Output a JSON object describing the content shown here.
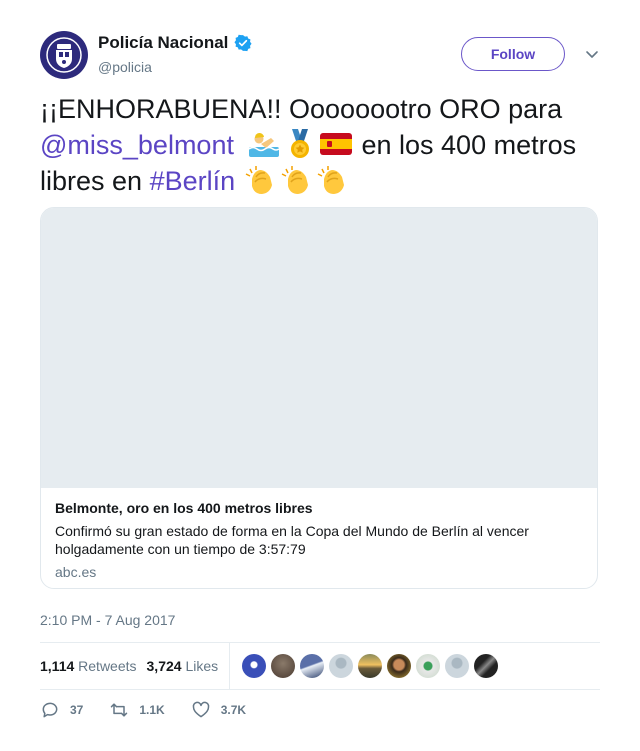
{
  "author": {
    "display_name": "Policía Nacional",
    "handle": "@policia",
    "verified": true,
    "avatar_icon": "police-badge-icon"
  },
  "follow_label": "Follow",
  "tweet": {
    "part1": "¡¡ENHORABUENA!! Oooooootro ORO para ",
    "mention": "@miss_belmont",
    "part2": " en los 400 metros libres en ",
    "hashtag": "#Berlín",
    "emojis": [
      "swimmer-emoji",
      "medal-emoji",
      "spain-flag-emoji",
      "clap-emoji",
      "clap-emoji",
      "clap-emoji"
    ]
  },
  "card": {
    "title": "Belmonte, oro en los 400 metros libres",
    "description": "Confirmó su gran estado de forma en la Copa del Mundo de Berlín al vencer holgadamente con un tiempo de 3:57:79",
    "domain": "abc.es"
  },
  "timestamp": "2:10 PM - 7 Aug 2017",
  "stats": {
    "retweets_count": "1,114",
    "retweets_label": "Retweets",
    "likes_count": "3,724",
    "likes_label": "Likes"
  },
  "actions": {
    "replies": "37",
    "retweets": "1.1K",
    "likes": "3.7K"
  },
  "colors": {
    "link": "#5b45c4",
    "verified": "#1da1f2",
    "muted": "#657786"
  }
}
